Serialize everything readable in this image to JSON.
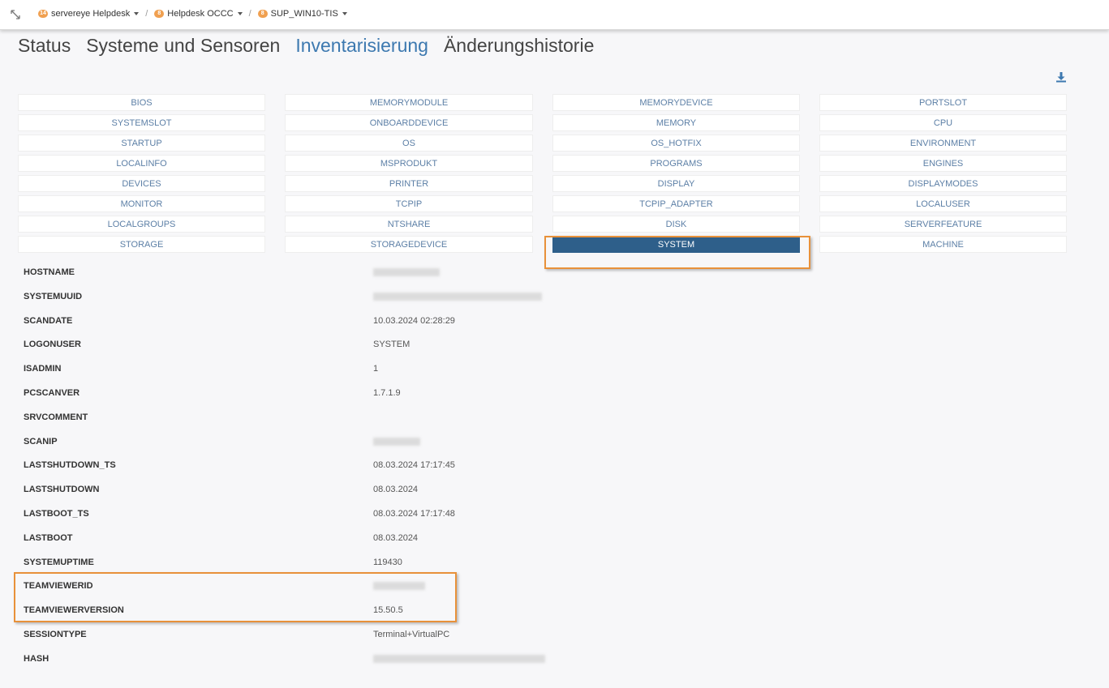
{
  "breadcrumb": [
    {
      "badge": "14",
      "label": "servereye Helpdesk"
    },
    {
      "badge": "8",
      "label": "Helpdesk OCCC"
    },
    {
      "badge": "8",
      "label": "SUP_WIN10-TIS"
    }
  ],
  "tabs": [
    {
      "label": "Status"
    },
    {
      "label": "Systeme und Sensoren"
    },
    {
      "label": "Inventarisierung",
      "active": true
    },
    {
      "label": "Änderungshistorie"
    }
  ],
  "categories": [
    "BIOS",
    "MEMORYMODULE",
    "MEMORYDEVICE",
    "PORTSLOT",
    "SYSTEMSLOT",
    "ONBOARDDEVICE",
    "MEMORY",
    "CPU",
    "STARTUP",
    "OS",
    "OS_HOTFIX",
    "ENVIRONMENT",
    "LOCALINFO",
    "MSPRODUKT",
    "PROGRAMS",
    "ENGINES",
    "DEVICES",
    "PRINTER",
    "DISPLAY",
    "DISPLAYMODES",
    "MONITOR",
    "TCPIP",
    "TCPIP_ADAPTER",
    "LOCALUSER",
    "LOCALGROUPS",
    "NTSHARE",
    "DISK",
    "SERVERFEATURE",
    "STORAGE",
    "STORAGEDEVICE",
    "SYSTEM",
    "MACHINE"
  ],
  "active_category": "SYSTEM",
  "properties": [
    {
      "key": "HOSTNAME",
      "value": ""
    },
    {
      "key": "SYSTEMUUID",
      "value": ""
    },
    {
      "key": "SCANDATE",
      "value": "10.03.2024 02:28:29"
    },
    {
      "key": "LOGONUSER",
      "value": "SYSTEM"
    },
    {
      "key": "ISADMIN",
      "value": "1"
    },
    {
      "key": "PCSCANVER",
      "value": "1.7.1.9"
    },
    {
      "key": "SRVCOMMENT",
      "value": ""
    },
    {
      "key": "SCANIP",
      "value": ""
    },
    {
      "key": "LASTSHUTDOWN_TS",
      "value": "08.03.2024 17:17:45"
    },
    {
      "key": "LASTSHUTDOWN",
      "value": "08.03.2024"
    },
    {
      "key": "LASTBOOT_TS",
      "value": "08.03.2024 17:17:48"
    },
    {
      "key": "LASTBOOT",
      "value": "08.03.2024"
    },
    {
      "key": "SYSTEMUPTIME",
      "value": "119430"
    },
    {
      "key": "TEAMVIEWERID",
      "value": ""
    },
    {
      "key": "TEAMVIEWERVERSION",
      "value": "15.50.5"
    },
    {
      "key": "SESSIONTYPE",
      "value": "Terminal+VirtualPC"
    },
    {
      "key": "HASH",
      "value": ""
    }
  ],
  "colors": {
    "accent": "#3d79b0",
    "active_button": "#2e5f8a",
    "highlight": "#e8913a",
    "badge": "#f0a050"
  },
  "icons": {
    "expand": "expand-arrows-icon",
    "download": "download-icon"
  }
}
